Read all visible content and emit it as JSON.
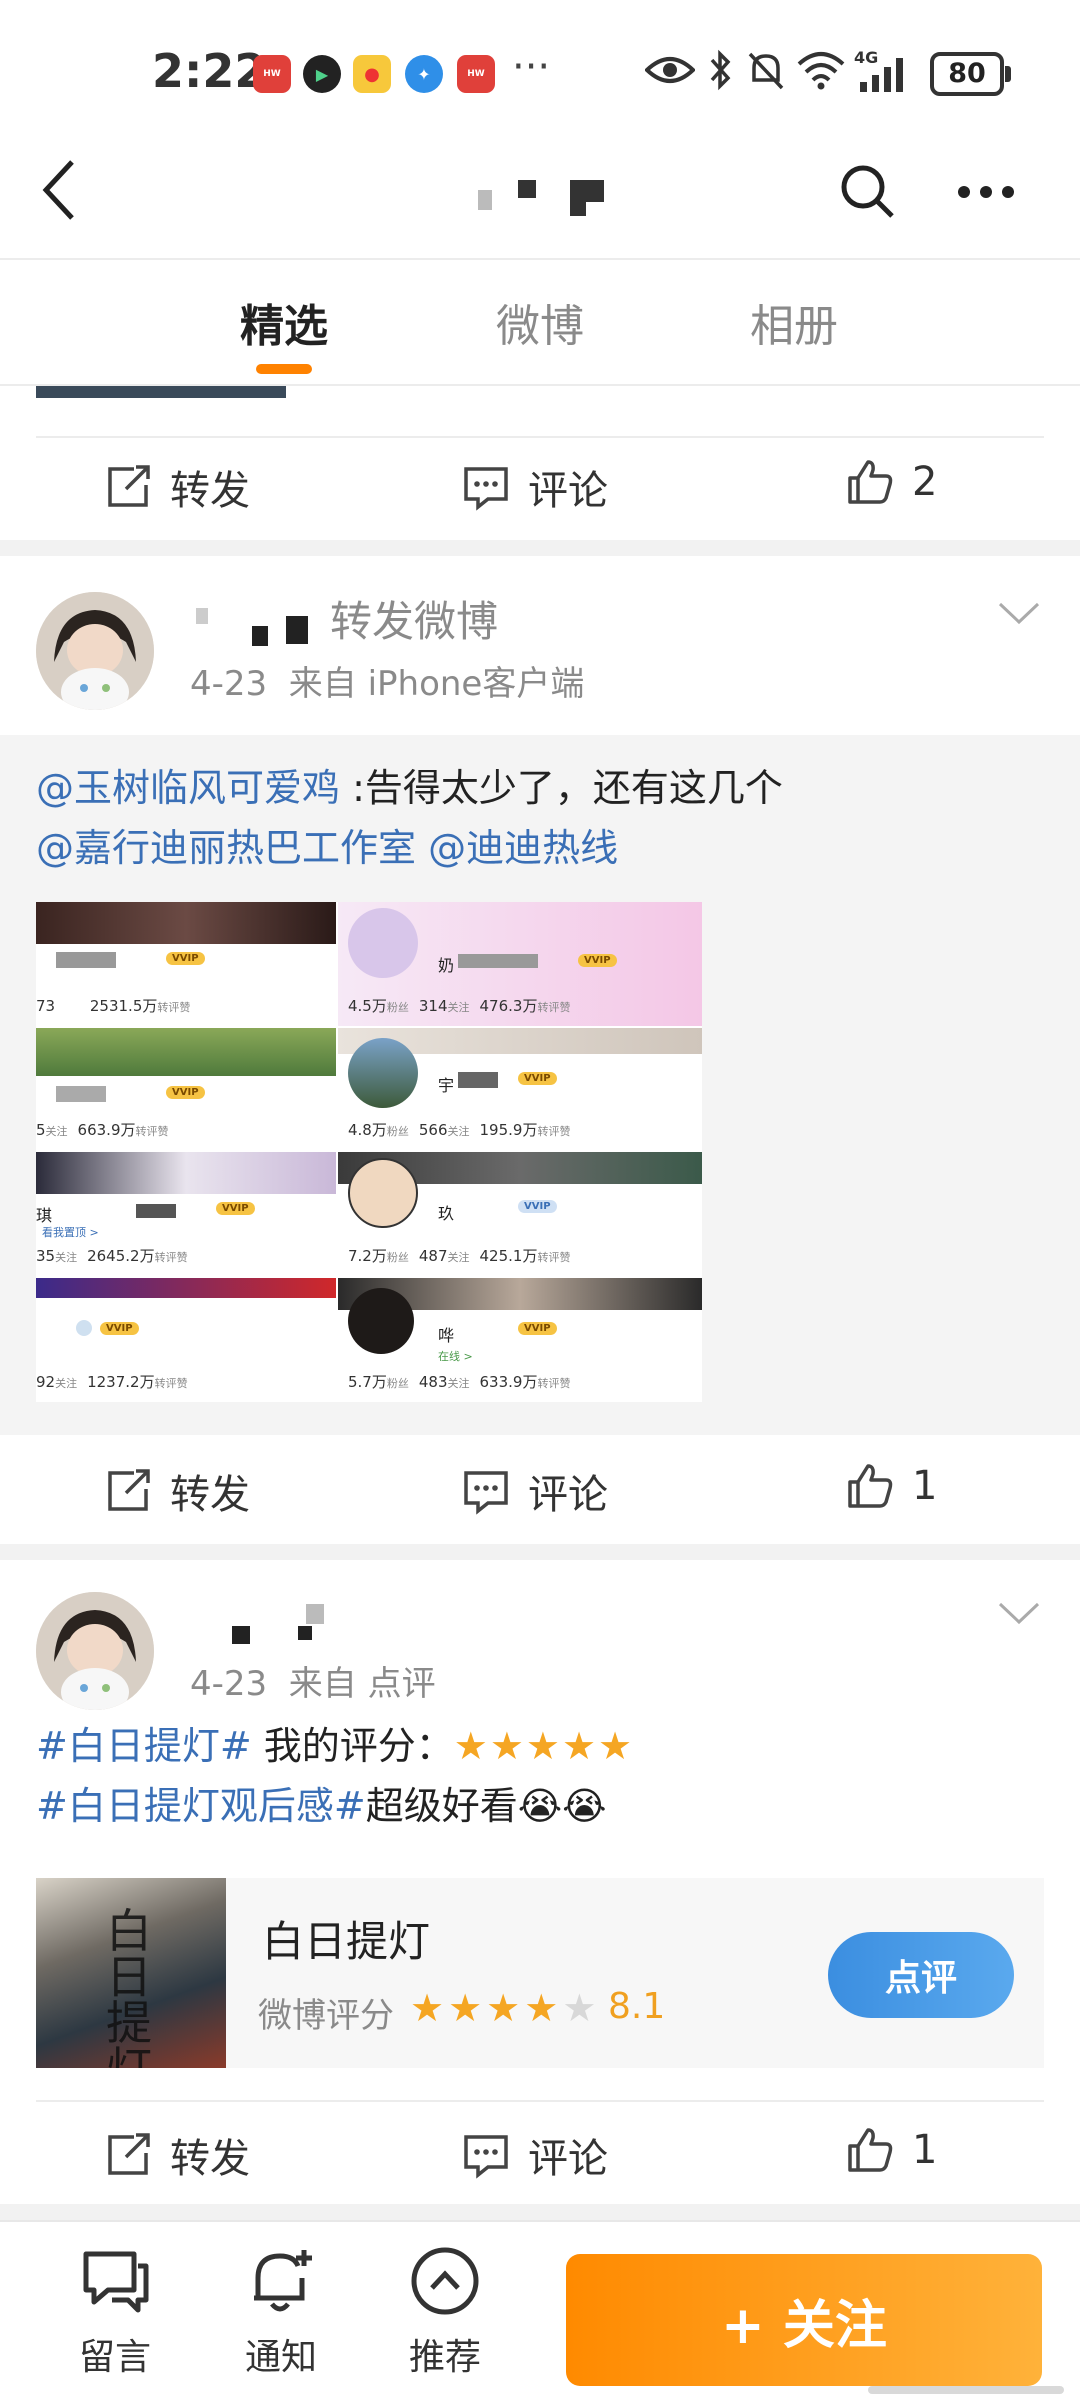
{
  "status_bar": {
    "time": "2:22",
    "more": "···",
    "network": "4G",
    "battery": "80",
    "notification_icons": [
      "huawei-appgallery-icon",
      "video-app-icon",
      "weibo-icon",
      "browser-icon",
      "huawei-appgallery-icon"
    ]
  },
  "header": {
    "back_icon": "back-arrow-icon",
    "search_icon": "search-icon",
    "more_icon": "more-dots-icon"
  },
  "tabs": [
    {
      "label": "精选",
      "active": true
    },
    {
      "label": "微博",
      "active": false
    },
    {
      "label": "相册",
      "active": false
    }
  ],
  "post0_actions": {
    "repost": "转发",
    "comment": "评论",
    "likes": "2"
  },
  "post1": {
    "action_label": "转发微博",
    "meta": "4-23  来自 iPhone客户端",
    "repost_text": {
      "mention1": "@玉树临风可爱鸡",
      "body": " :告得太少了，还有这几个",
      "mention2": "@嘉行迪丽热巴工作室",
      "mention3": "@迪迪热线"
    },
    "collage": {
      "left": [
        {
          "stats_a": "73",
          "stats_b": "2531.5万",
          "label_b": "转评赞",
          "badge": "VVIP"
        },
        {
          "stats_a": "5",
          "label_a": "关注",
          "stats_b": "663.9万",
          "label_b": "转评赞",
          "badge": "VVIP"
        },
        {
          "prefix": "琪",
          "link": "看我置顶 >",
          "stats_a": "35",
          "label_a": "关注",
          "stats_b": "2645.2万",
          "label_b": "转评赞",
          "badge": "VVIP"
        },
        {
          "stats_a": "92",
          "label_a": "关注",
          "stats_b": "1237.2万",
          "label_b": "转评赞",
          "badge": "VVIP"
        }
      ],
      "right": [
        {
          "name": "奶",
          "fans": "4.5万",
          "label_fans": "粉丝",
          "follow": "314",
          "label_follow": "关注",
          "likes": "476.3万",
          "label_likes": "转评赞",
          "badge": "VVIP"
        },
        {
          "name": "宇",
          "fans": "4.8万",
          "label_fans": "粉丝",
          "follow": "566",
          "label_follow": "关注",
          "likes": "195.9万",
          "label_likes": "转评赞",
          "badge": "VVIP"
        },
        {
          "name": "玖",
          "fans": "7.2万",
          "label_fans": "粉丝",
          "follow": "487",
          "label_follow": "关注",
          "likes": "425.1万",
          "label_likes": "转评赞",
          "badge": "VVIP"
        },
        {
          "name": "哗",
          "sub": "在线 >",
          "fans": "5.7万",
          "label_fans": "粉丝",
          "follow": "483",
          "label_follow": "关注",
          "likes": "633.9万",
          "label_likes": "转评赞",
          "badge": "VVIP"
        }
      ]
    },
    "actions": {
      "repost": "转发",
      "comment": "评论",
      "likes": "1"
    }
  },
  "post2": {
    "meta": "4-23  来自 点评",
    "line1_tag": "#白日提灯#",
    "line1_text": " 我的评分：",
    "line1_stars": "★★★★★",
    "line2_tag": "#白日提灯观后感#",
    "line2_text": "超级好看",
    "line2_emoji": "😭😭",
    "movie": {
      "title": "白日提灯",
      "rating_label": "微博评分",
      "score": "8.1",
      "stars_filled": 4,
      "button": "点评",
      "poster_text": "白日提灯"
    },
    "actions": {
      "repost": "转发",
      "comment": "评论",
      "likes": "1"
    }
  },
  "bottom_nav": {
    "message": "留言",
    "notify": "通知",
    "recommend": "推荐",
    "follow": "+ 关注"
  },
  "colors": {
    "accent": "#ff8200",
    "link": "#3a6fb6",
    "star": "#f5a623",
    "review_button": "#3b8ee0"
  }
}
